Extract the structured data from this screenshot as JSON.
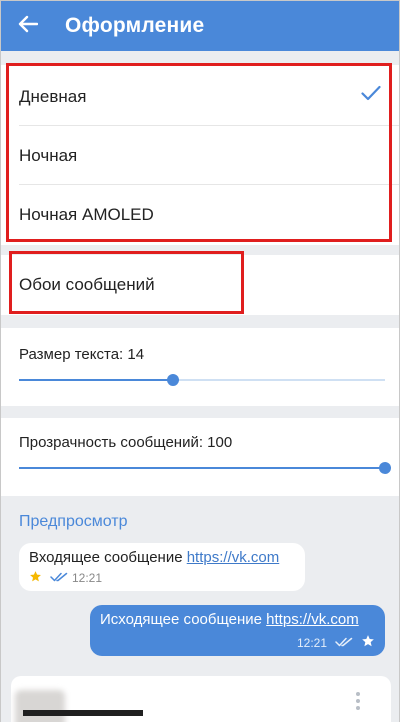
{
  "appbar": {
    "title": "Оформление",
    "back_icon": "arrow-left-icon",
    "background": "#4a88d9"
  },
  "themes": {
    "items": [
      {
        "label": "Дневная",
        "selected": true
      },
      {
        "label": "Ночная",
        "selected": false
      },
      {
        "label": "Ночная AMOLED",
        "selected": false
      }
    ],
    "check_icon": "checkmark-icon"
  },
  "wallpaper": {
    "label": "Обои сообщений"
  },
  "text_size": {
    "label": "Размер текста: 14",
    "value": 14,
    "level": 0.42
  },
  "transparency": {
    "label": "Прозрачность сообщений: 100",
    "value": 100,
    "level": 1.0
  },
  "preview": {
    "title": "Предпросмотр",
    "incoming": {
      "text": "Входящее сообщение ",
      "link": "https://vk.com",
      "time": "12:21"
    },
    "outgoing": {
      "text": "Исходящее сообщение ",
      "link": "https://vk.com",
      "time": "12:21"
    }
  },
  "colors": {
    "accent": "#4a88d9",
    "annotation": "#e01e1e",
    "star": "#f5b800"
  }
}
